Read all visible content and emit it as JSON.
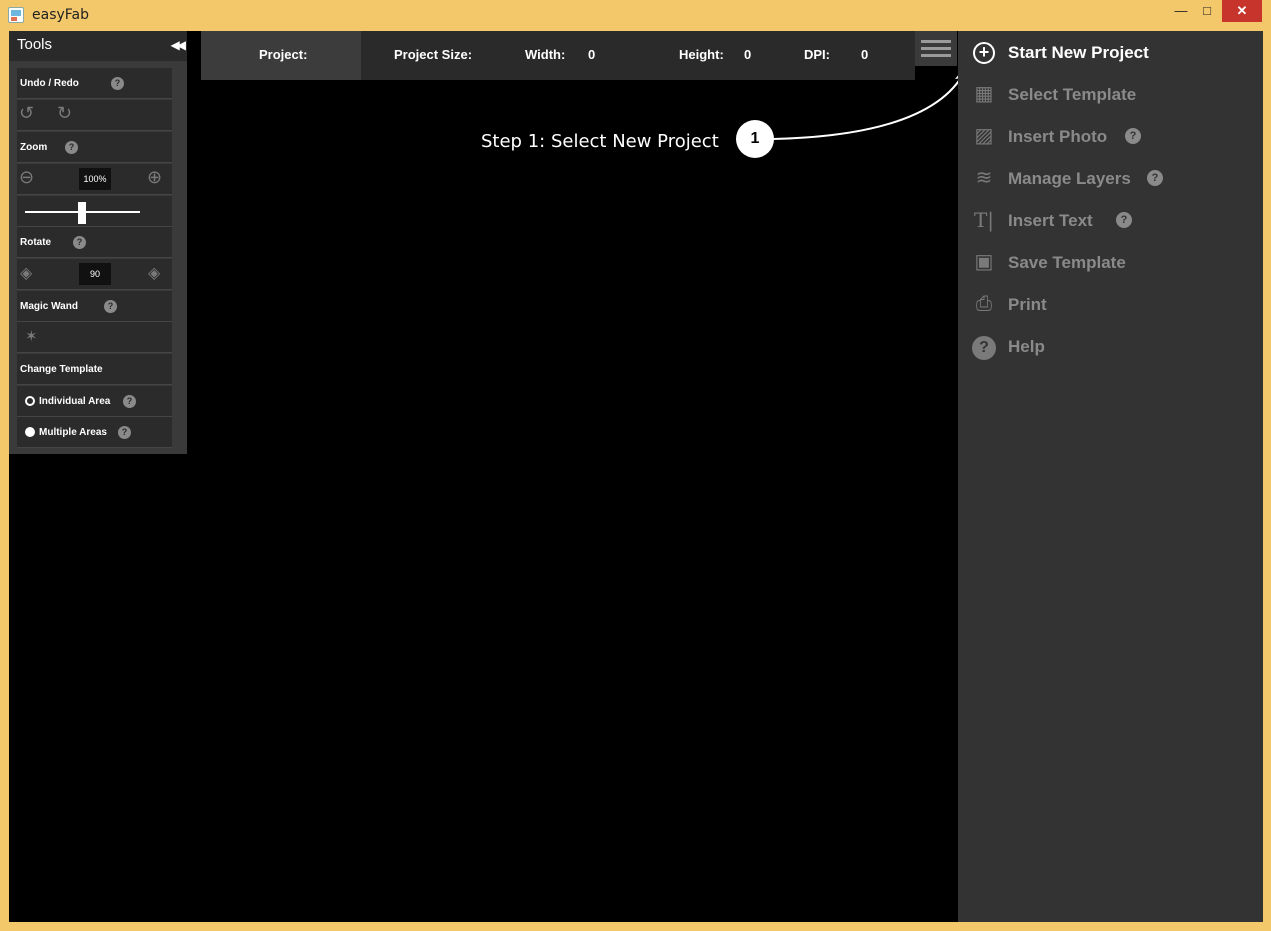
{
  "window": {
    "title": "easyFab",
    "minimize": "—",
    "maximize": "□",
    "close": "✕"
  },
  "tools": {
    "header": "Tools",
    "collapse": "◀◀",
    "undo_redo_label": "Undo / Redo",
    "zoom_label": "Zoom",
    "zoom_value": "100%",
    "zoom_slider_fraction": 0.5,
    "rotate_label": "Rotate",
    "rotate_value": "90",
    "magic_wand_label": "Magic Wand",
    "change_template_label": "Change Template",
    "individual_area_label": "Individual Area",
    "multiple_areas_label": "Multiple Areas",
    "help_glyph": "?"
  },
  "project_bar": {
    "project_label": "Project:",
    "size_label": "Project Size:",
    "width_label": "Width:",
    "width_value": "0",
    "height_label": "Height:",
    "height_value": "0",
    "dpi_label": "DPI:",
    "dpi_value": "0"
  },
  "annotation": {
    "step_text": "Step 1:  Select New Project",
    "step_number": "1"
  },
  "menu": {
    "items": [
      {
        "label": "Start New Project",
        "icon": "plus-circle-icon",
        "active": true
      },
      {
        "label": "Select Template",
        "icon": "template-icon"
      },
      {
        "label": "Insert Photo",
        "icon": "photo-icon",
        "help": true
      },
      {
        "label": "Manage Layers",
        "icon": "layers-icon",
        "help": true
      },
      {
        "label": "Insert Text",
        "icon": "text-icon",
        "help": true
      },
      {
        "label": "Save Template",
        "icon": "save-template-icon"
      },
      {
        "label": "Print",
        "icon": "print-icon"
      },
      {
        "label": "Help",
        "icon": "help-icon"
      }
    ]
  },
  "colors": {
    "frame": "#f3c86a",
    "canvas": "#000000",
    "panel": "#333333",
    "close_button": "#c7342b"
  }
}
